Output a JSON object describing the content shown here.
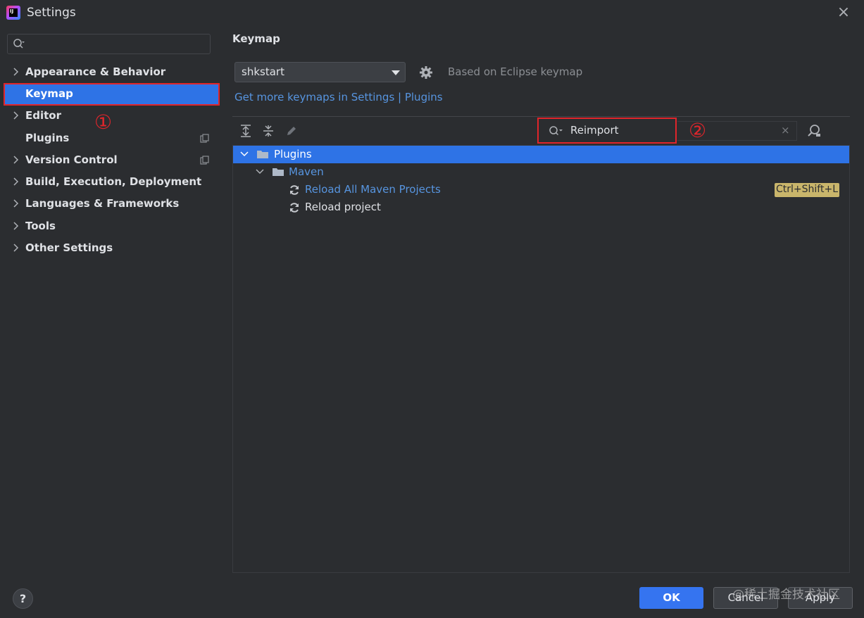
{
  "window": {
    "title": "Settings",
    "close_glyph": "×",
    "app_icon_text": "IJ"
  },
  "sidebar": {
    "search_placeholder": "",
    "items": [
      {
        "label": "Appearance & Behavior",
        "expandable": true
      },
      {
        "label": "Keymap",
        "selected": true
      },
      {
        "label": "Editor",
        "expandable": true
      },
      {
        "label": "Plugins",
        "has_copy_icon": true
      },
      {
        "label": "Version Control",
        "expandable": true,
        "has_copy_icon": true
      },
      {
        "label": "Build, Execution, Deployment",
        "expandable": true
      },
      {
        "label": "Languages & Frameworks",
        "expandable": true
      },
      {
        "label": "Tools",
        "expandable": true
      },
      {
        "label": "Other Settings",
        "expandable": true
      }
    ]
  },
  "annotations": {
    "one": "①",
    "two": "②"
  },
  "main": {
    "title": "Keymap",
    "keymap_select_value": "shkstart",
    "based_on": "Based on Eclipse keymap",
    "get_more_link": "Get more keymaps in Settings | Plugins",
    "filter_value": "Reimport",
    "filter_clear_glyph": "×",
    "tree": [
      {
        "label": "Plugins",
        "type": "folder",
        "selected": true
      },
      {
        "label": "Maven",
        "type": "folder"
      },
      {
        "label": "Reload All Maven Projects",
        "type": "action",
        "shortcut": "Ctrl+Shift+L"
      },
      {
        "label": "Reload project",
        "type": "action"
      }
    ]
  },
  "footer": {
    "help_label": "?",
    "ok_label": "OK",
    "cancel_label": "Cancel",
    "apply_label": "Apply"
  },
  "watermark": "@稀土掘金技术社区",
  "colors": {
    "background": "#2b2d30",
    "selection": "#2e73e6",
    "highlight_border": "#e0252b",
    "link": "#5795e0",
    "shortcut_badge": "#c9b56b"
  }
}
